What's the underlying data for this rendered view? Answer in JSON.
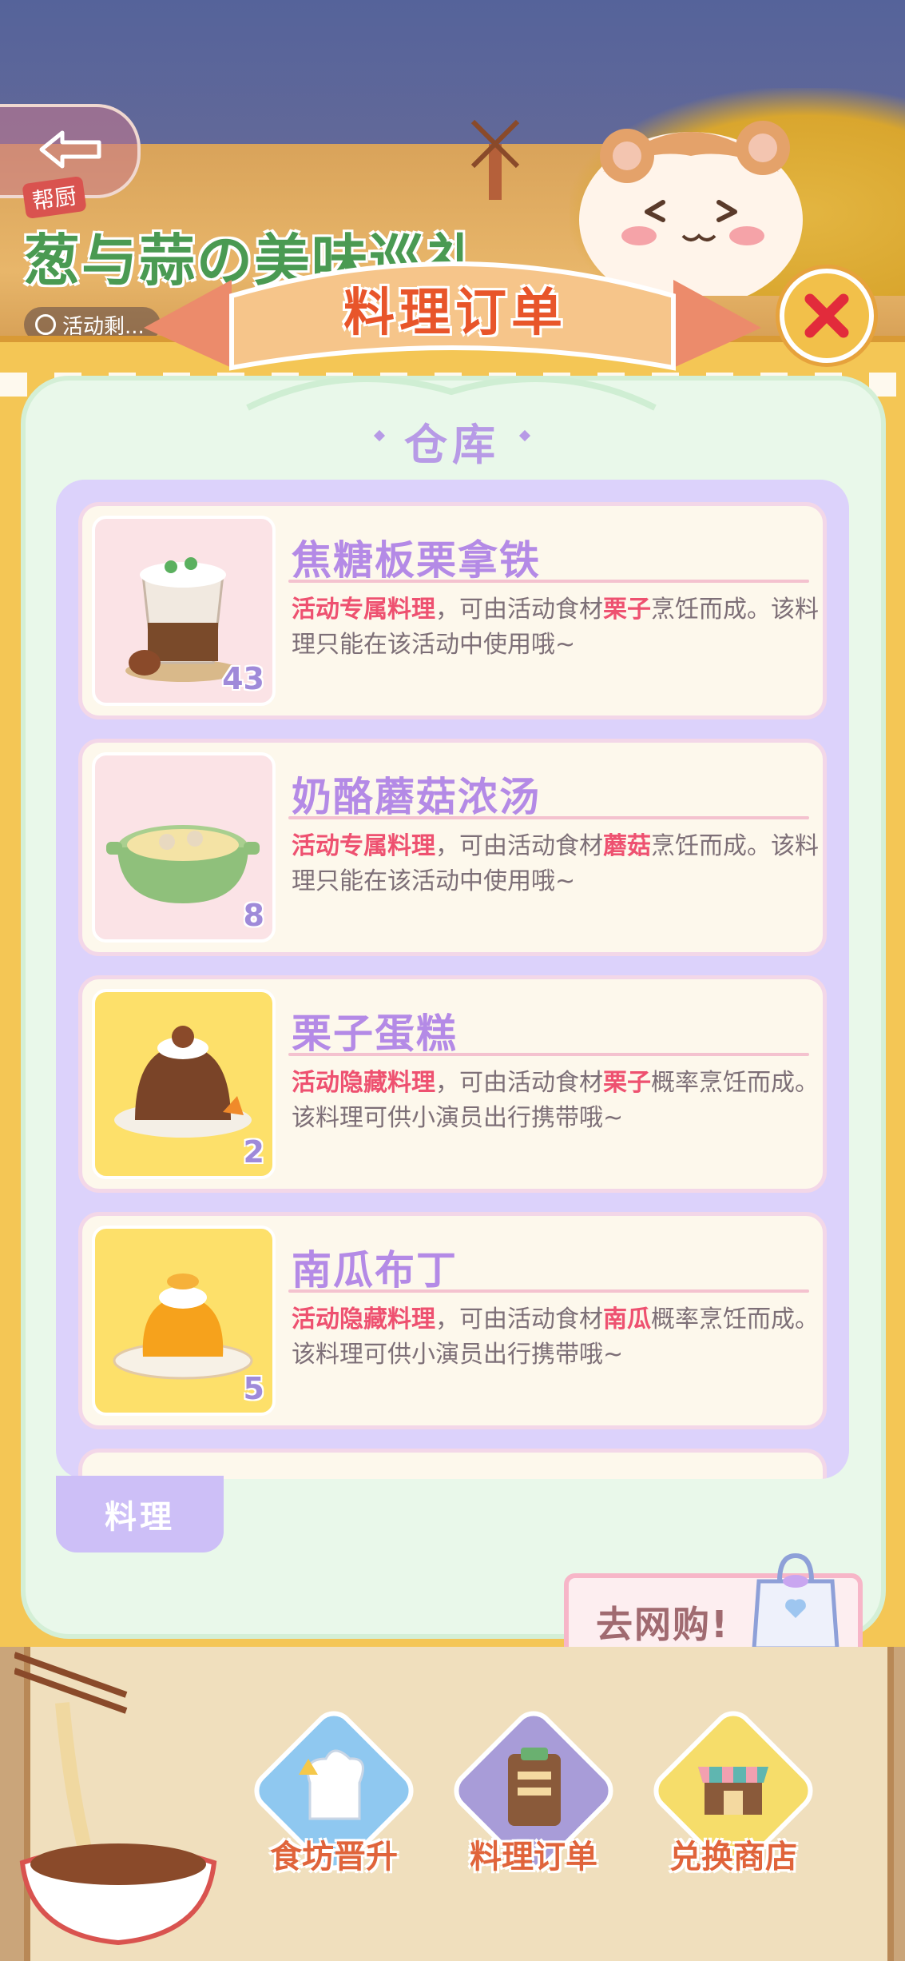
{
  "header": {
    "event_title": "葱与蒜の美味巡礼",
    "event_tag": "帮厨",
    "timer_label": "活动剩..."
  },
  "dialog": {
    "title": "料理订单",
    "section_title": "仓库",
    "items": [
      {
        "name": "焦糖板栗拿铁",
        "count": "43",
        "tag": "活动专属料理",
        "desc_prefix": "，可由活动食材",
        "ingredient": "栗子",
        "desc_suffix": "烹饪而成。该料理只能在该活动中使用哦~"
      },
      {
        "name": "奶酪蘑菇浓汤",
        "count": "8",
        "tag": "活动专属料理",
        "desc_prefix": "，可由活动食材",
        "ingredient": "蘑菇",
        "desc_suffix": "烹饪而成。该料理只能在该活动中使用哦~"
      },
      {
        "name": "栗子蛋糕",
        "count": "2",
        "tag": "活动隐藏料理",
        "desc_prefix": "，可由活动食材",
        "ingredient": "栗子",
        "desc_suffix": "概率烹饪而成。该料理可供小演员出行携带哦~"
      },
      {
        "name": "南瓜布丁",
        "count": "5",
        "tag": "活动隐藏料理",
        "desc_prefix": "，可由活动食材",
        "ingredient": "南瓜",
        "desc_suffix": "概率烹饪而成。该料理可供小演员出行携带哦~"
      }
    ],
    "tab_label": "料理",
    "shop_button": "去网购!"
  },
  "bottom_nav": {
    "items": [
      {
        "label": "食坊晋升",
        "icon": "chef-hat-icon"
      },
      {
        "label": "料理订单",
        "icon": "clipboard-icon"
      },
      {
        "label": "兑换商店",
        "icon": "shop-icon"
      }
    ]
  },
  "colors": {
    "accent_red": "#ee5170",
    "title_orange": "#e8552a",
    "purple": "#b48ae6",
    "card_green": "#e9f8ea",
    "gold": "#f4c655"
  }
}
